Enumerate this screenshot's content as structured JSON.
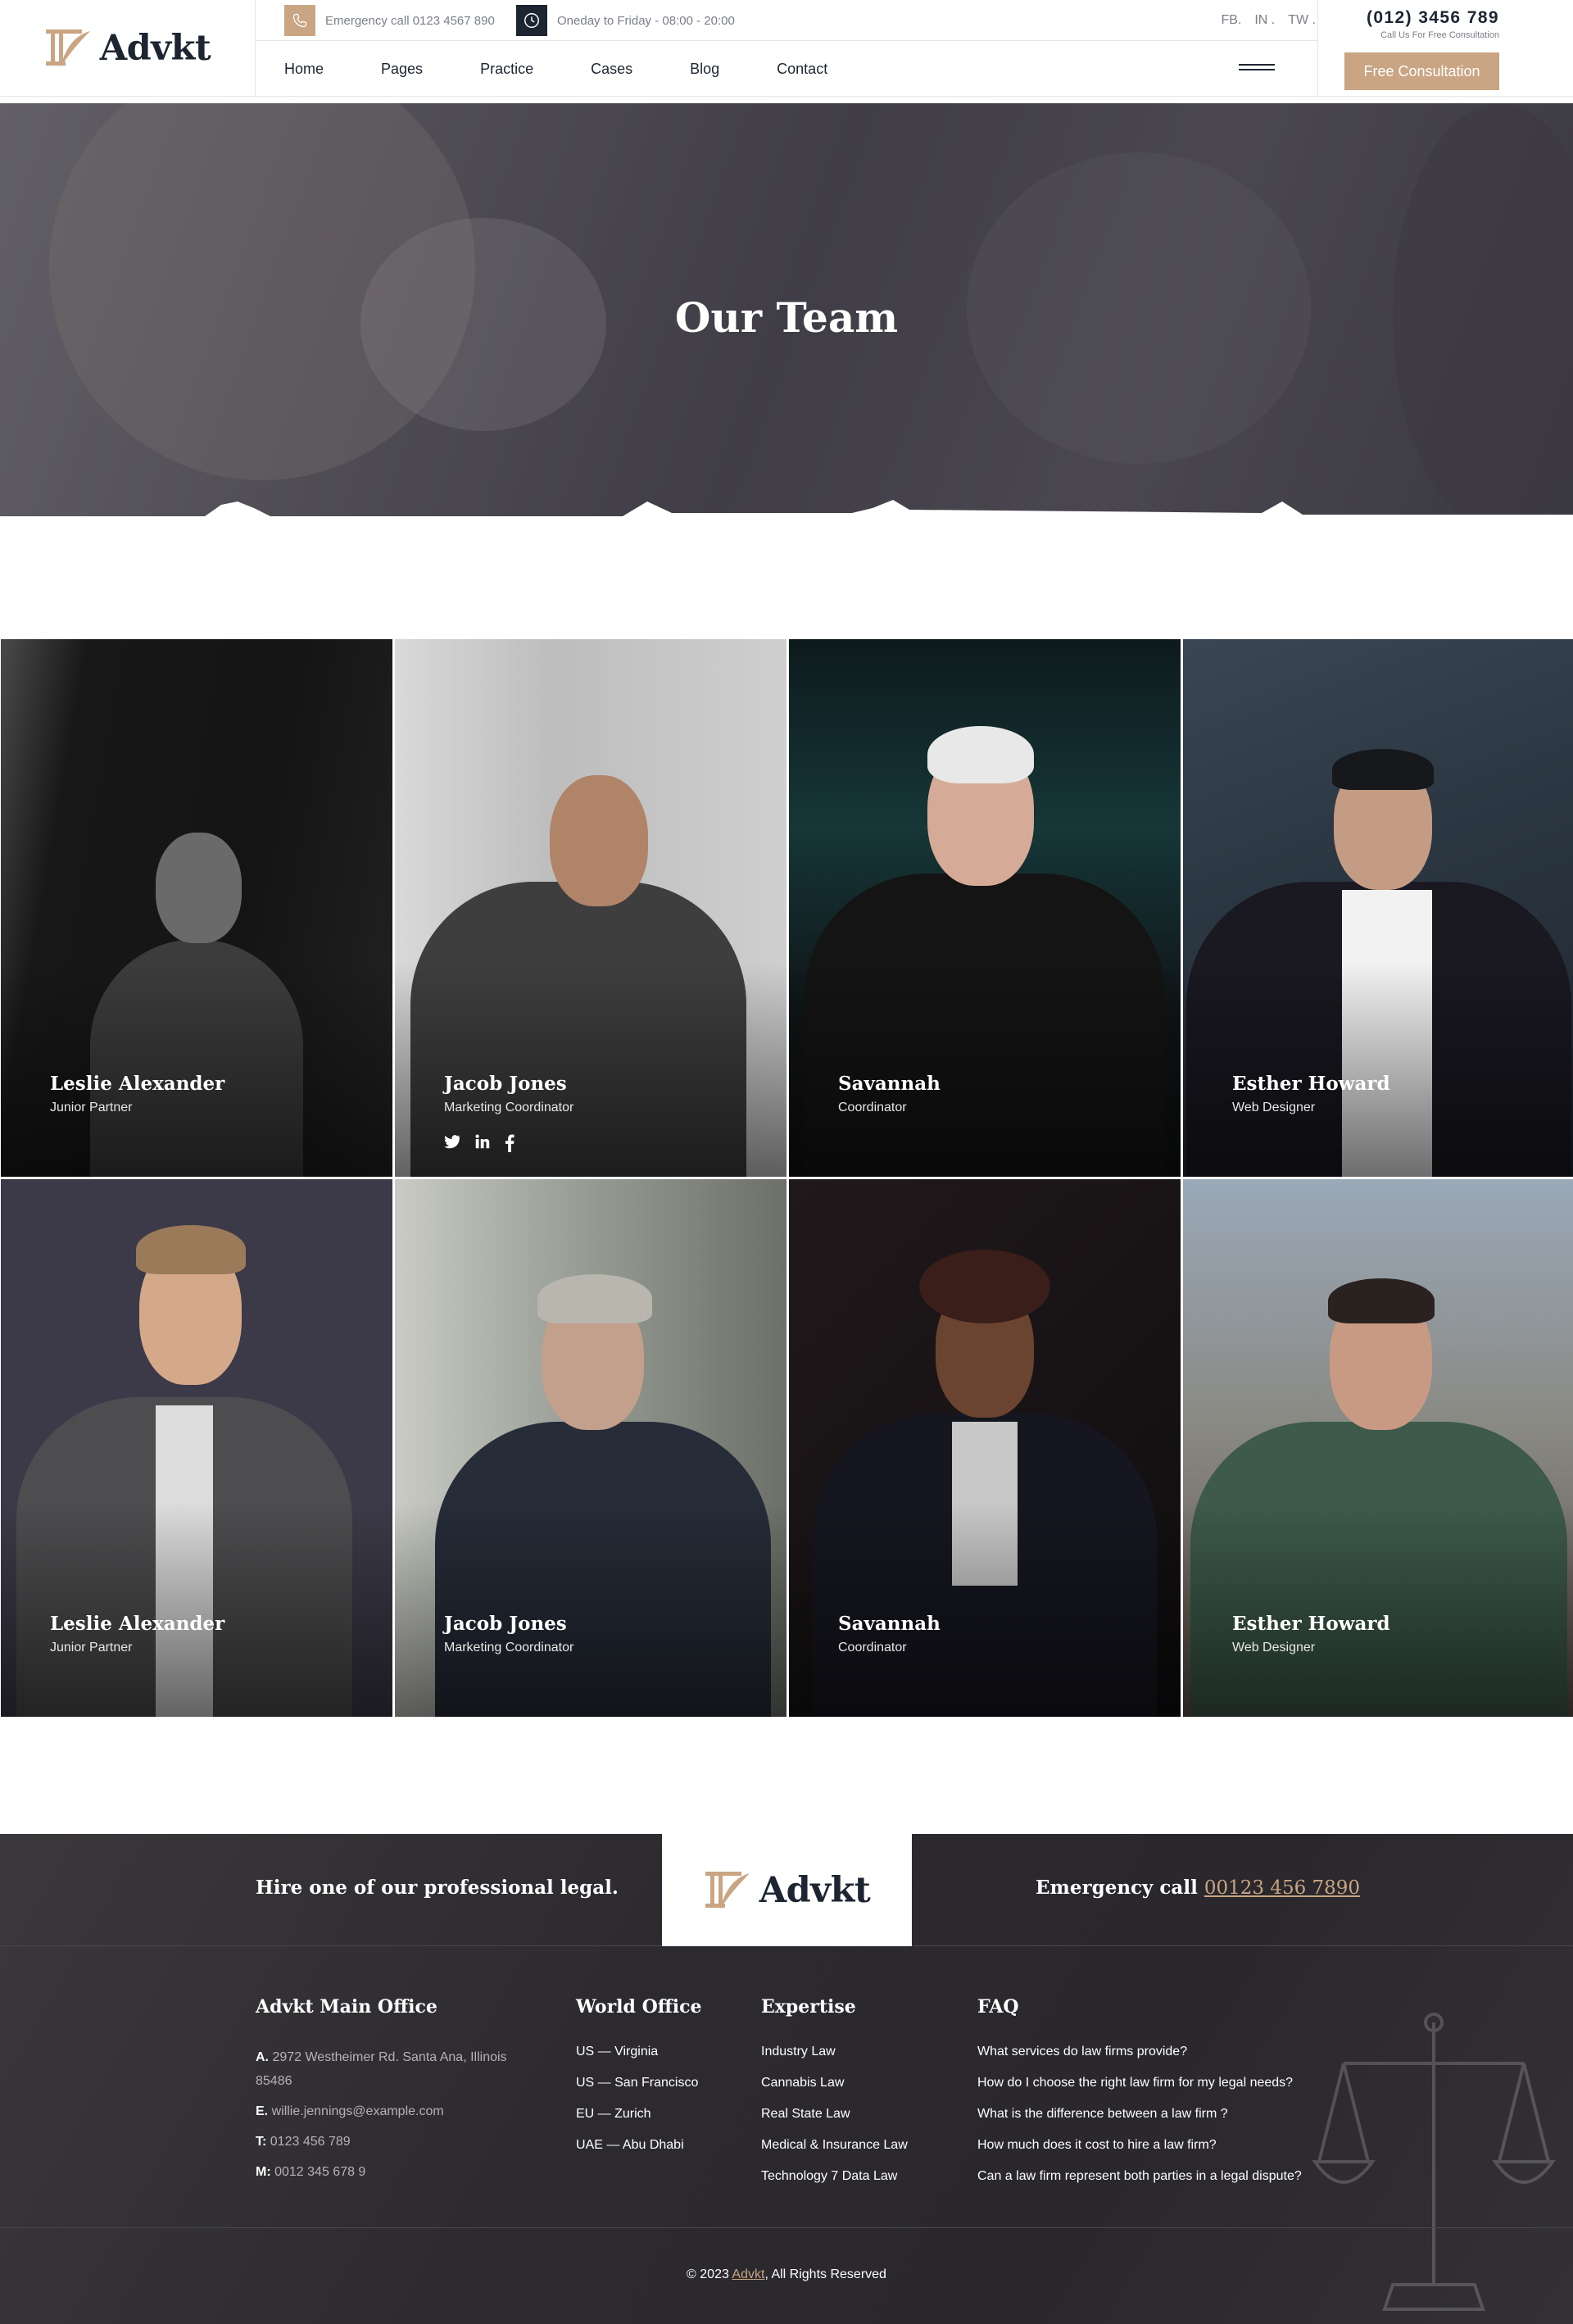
{
  "header": {
    "logo_text": "Advkt",
    "emergency": "Emergency call 0123 4567 890",
    "hours": "Oneday to Friday - 08:00 - 20:00",
    "social": [
      "FB.",
      "IN .",
      "TW ."
    ],
    "nav": [
      "Home",
      "Pages",
      "Practice",
      "Cases",
      "Blog",
      "Contact"
    ],
    "phone": "(012) 3456 789",
    "phone_sub": "Call Us For Free Consultation",
    "cta": "Free Consultation"
  },
  "hero": {
    "title": "Our Team"
  },
  "team": [
    {
      "name": "Leslie Alexander",
      "role": "Junior Partner"
    },
    {
      "name": "Jacob Jones",
      "role": "Marketing Coordinator",
      "social_icons": [
        "twitter-icon",
        "linkedin-icon",
        "facebook-icon"
      ]
    },
    {
      "name": "Savannah",
      "role": "Coordinator"
    },
    {
      "name": "Esther Howard",
      "role": "Web Designer"
    },
    {
      "name": "Leslie Alexander",
      "role": "Junior Partner"
    },
    {
      "name": "Jacob Jones",
      "role": "Marketing Coordinator"
    },
    {
      "name": "Savannah",
      "role": "Coordinator"
    },
    {
      "name": "Esther Howard",
      "role": "Web Designer"
    }
  ],
  "footer": {
    "hire": "Hire one of our professional legal.",
    "logo_text": "Advkt",
    "emergency_label": "Emergency call",
    "emergency_number": "00123 456 7890",
    "office": {
      "title": "Advkt Main Office",
      "address_label": "A.",
      "address": "2972 Westheimer Rd. Santa Ana, Illinois 85486",
      "email_label": "E.",
      "email": "willie.jennings@example.com",
      "tel_label": "T:",
      "tel": "0123 456 789",
      "mobile_label": "M:",
      "mobile": "0012 345 678 9"
    },
    "world": {
      "title": "World Office",
      "items": [
        "US — Virginia",
        "US — San Francisco",
        "EU — Zurich",
        "UAE — Abu Dhabi"
      ]
    },
    "expertise": {
      "title": "Expertise",
      "items": [
        "Industry Law",
        "Cannabis Law",
        "Real State Law",
        "Medical & Insurance Law",
        "Technology 7 Data Law"
      ]
    },
    "faq": {
      "title": "FAQ",
      "items": [
        "What services do law firms provide?",
        "How do I choose the right law firm for my legal needs?",
        "What is the difference between a law firm ?",
        "How much does it cost to hire a law firm?",
        "Can a law firm represent both parties in a legal dispute?"
      ]
    },
    "copyright_pre": "© 2023",
    "copyright_brand": "Advkt",
    "copyright_post": ", All Rights Reserved"
  },
  "colors": {
    "accent": "#c9a583",
    "dark": "#1c2531",
    "footer_bg": "#2f2d31"
  }
}
